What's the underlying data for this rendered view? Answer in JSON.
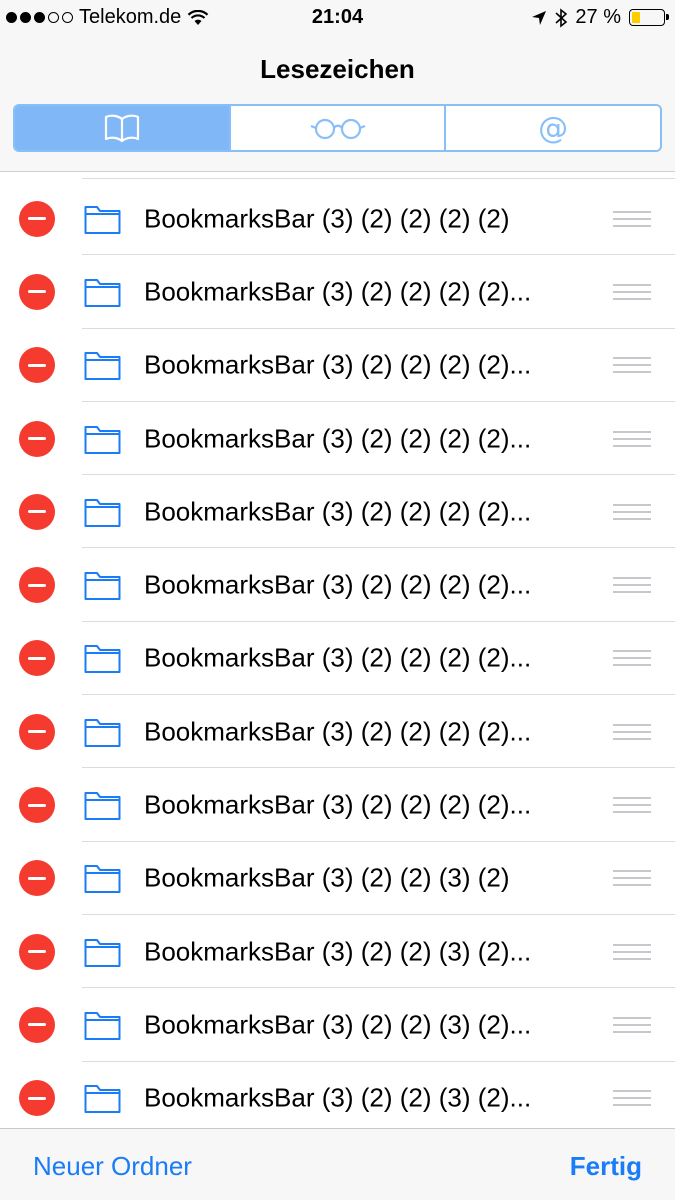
{
  "status_bar": {
    "carrier": "Telekom.de",
    "time": "21:04",
    "battery_percent": "27 %",
    "battery_level": 0.27,
    "signal_bars_filled": 3,
    "signal_bars_total": 5,
    "icons": [
      "wifi-icon",
      "location-arrow-icon",
      "bluetooth-icon",
      "battery-icon"
    ]
  },
  "header": {
    "title": "Lesezeichen",
    "segments": [
      {
        "name": "bookmarks",
        "icon": "book-icon",
        "active": true
      },
      {
        "name": "reading-list",
        "icon": "glasses-icon",
        "active": false
      },
      {
        "name": "shared-links",
        "icon": "at-icon",
        "label": "@",
        "active": false
      }
    ]
  },
  "bookmarks": [
    "BookmarksBar (3) (2) (2) (2) (2)",
    "BookmarksBar (3) (2) (2) (2) (2)...",
    "BookmarksBar (3) (2) (2) (2) (2)...",
    "BookmarksBar (3) (2) (2) (2) (2)...",
    "BookmarksBar (3) (2) (2) (2) (2)...",
    "BookmarksBar (3) (2) (2) (2) (2)...",
    "BookmarksBar (3) (2) (2) (2) (2)...",
    "BookmarksBar (3) (2) (2) (2) (2)...",
    "BookmarksBar (3) (2) (2) (2) (2)...",
    "BookmarksBar (3) (2) (2) (3) (2)",
    "BookmarksBar (3) (2) (2) (3) (2)...",
    "BookmarksBar (3) (2) (2) (3) (2)...",
    "BookmarksBar (3) (2) (2) (3) (2)..."
  ],
  "toolbar": {
    "new_folder_label": "Neuer Ordner",
    "done_label": "Fertig"
  },
  "colors": {
    "accent": "#1a7cf6",
    "segment_active": "#7fb7f7",
    "delete_red": "#f53b30",
    "battery_yellow": "#ffcc00"
  }
}
